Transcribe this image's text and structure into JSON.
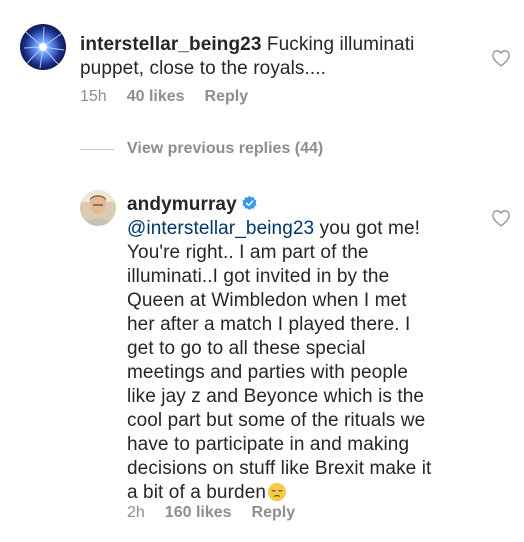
{
  "comment1": {
    "avatar_icon": "plasma-globe-avatar",
    "username": "interstellar_being23",
    "text": " Fucking illuminati puppet, close to the royals....",
    "time": "15h",
    "likes": "40 likes",
    "reply_label": "Reply",
    "like_icon": "heart-outline-icon"
  },
  "view_replies": {
    "label": "View previous replies (44)"
  },
  "comment2": {
    "avatar_icon": "person-avatar",
    "username": "andymurray",
    "verified_icon": "verified-badge-icon",
    "mention": "@interstellar_being23",
    "text": " you got me! You're right.. I am part of the illuminati..I got invited in by the Queen at Wimbledon when I met her after a match I played there. I get to go to all these special meetings and parties with people like jay z and Beyonce which is the cool part but some of the rituals we have to participate in and making decisions on stuff like Brexit make it a bit of a burden",
    "emoji": "pensive-face-emoji",
    "time": "2h",
    "likes": "160 likes",
    "reply_label": "Reply",
    "like_icon": "heart-outline-icon"
  },
  "colors": {
    "text": "#262626",
    "meta": "#8e8e8e",
    "mention": "#003569",
    "verified": "#3897f0"
  }
}
